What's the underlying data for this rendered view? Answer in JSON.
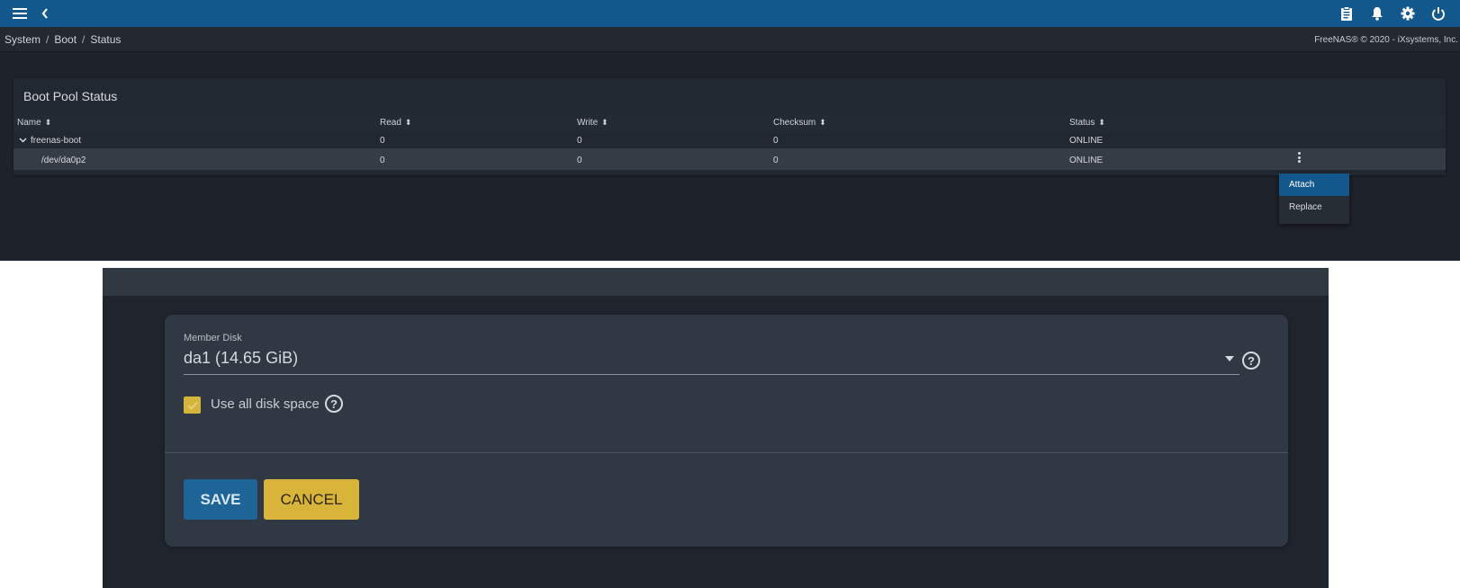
{
  "topbar": {
    "color": "#12588c",
    "left_icons": [
      "menu-icon",
      "back-chevron-icon"
    ],
    "right_icons": [
      "clipboard-icon",
      "bell-icon",
      "gear-icon",
      "power-icon"
    ]
  },
  "breadcrumb": {
    "items": [
      "System",
      "Boot",
      "Status"
    ],
    "separator": "/"
  },
  "copyright": "FreeNAS® © 2020 - iXsystems, Inc.",
  "boot_pool": {
    "title": "Boot Pool Status",
    "columns": [
      "Name",
      "Read",
      "Write",
      "Checksum",
      "Status"
    ],
    "sort_glyph": "⬍",
    "rows": [
      {
        "name": "freenas-boot",
        "read": "0",
        "write": "0",
        "checksum": "0",
        "status": "ONLINE",
        "expanded": true
      },
      {
        "name": "/dev/da0p2",
        "read": "0",
        "write": "0",
        "checksum": "0",
        "status": "ONLINE"
      }
    ]
  },
  "context_menu": {
    "items": [
      "Attach",
      "Replace"
    ],
    "highlighted": "Attach"
  },
  "attach_form": {
    "member_disk_label": "Member Disk",
    "member_disk_value": "da1 (14.65 GiB)",
    "use_all_label": "Use all disk space",
    "use_all_checked": true,
    "help_glyph": "?",
    "save_label": "SAVE",
    "cancel_label": "CANCEL",
    "save_color": "#1f6497",
    "cancel_color": "#d8b53a"
  }
}
